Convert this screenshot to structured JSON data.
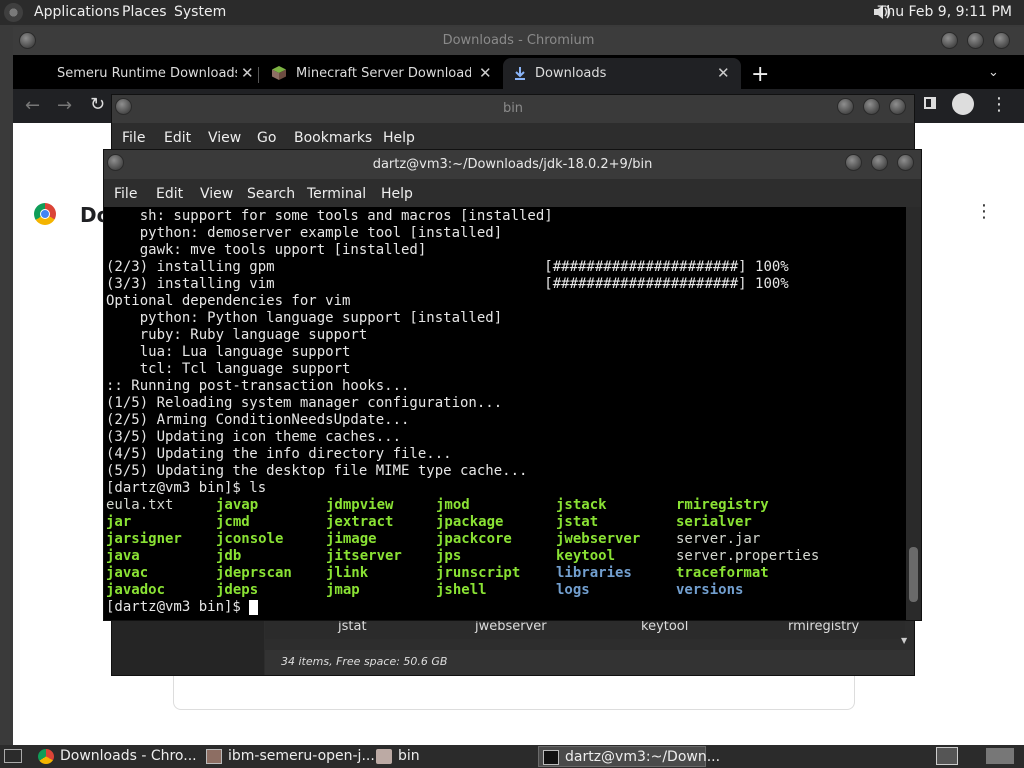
{
  "top_panel": {
    "menus": [
      "Applications",
      "Places",
      "System"
    ],
    "clock": "Thu Feb  9, 9:11 PM"
  },
  "chromium": {
    "title": "Downloads - Chromium",
    "tabs": [
      {
        "label": "Semeru Runtime Downloads -",
        "icon": "ibm-icon"
      },
      {
        "label": "Minecraft Server Download | M",
        "icon": "minecraft-block-icon"
      },
      {
        "label": "Downloads",
        "icon": "download-icon"
      }
    ],
    "new_tab": "+",
    "page_title_partial": "Do"
  },
  "file_manager": {
    "title": "bin",
    "menu": [
      "File",
      "Edit",
      "View",
      "Go",
      "Bookmarks",
      "Help"
    ],
    "grid_items": [
      "jstat",
      "jwebserver",
      "keytool",
      "rmiregistry"
    ],
    "status": "34 items, Free space: 50.6 GB"
  },
  "terminal": {
    "title": "dartz@vm3:~/Downloads/jdk-18.0.2+9/bin",
    "menu": [
      "File",
      "Edit",
      "View",
      "Search",
      "Terminal",
      "Help"
    ],
    "lines": [
      "    sh: support for some tools and macros [installed]",
      "    python: demoserver example tool [installed]",
      "    gawk: mve tools upport [installed]",
      "(2/3) installing gpm                                [######################] 100%",
      "(3/3) installing vim                                [######################] 100%",
      "Optional dependencies for vim",
      "    python: Python language support [installed]",
      "    ruby: Ruby language support",
      "    lua: Lua language support",
      "    tcl: Tcl language support",
      ":: Running post-transaction hooks...",
      "(1/5) Reloading system manager configuration...",
      "(2/5) Arming ConditionNeedsUpdate...",
      "(3/5) Updating icon theme caches...",
      "(4/5) Updating the info directory file...",
      "(5/5) Updating the desktop file MIME type cache...",
      "[dartz@vm3 bin]$ ls"
    ],
    "ls_columns": [
      [
        {
          "n": "eula.txt",
          "t": "file"
        },
        {
          "n": "jar",
          "t": "exec"
        },
        {
          "n": "jarsigner",
          "t": "exec"
        },
        {
          "n": "java",
          "t": "exec"
        },
        {
          "n": "javac",
          "t": "exec"
        },
        {
          "n": "javadoc",
          "t": "exec"
        }
      ],
      [
        {
          "n": "javap",
          "t": "exec"
        },
        {
          "n": "jcmd",
          "t": "exec"
        },
        {
          "n": "jconsole",
          "t": "exec"
        },
        {
          "n": "jdb",
          "t": "exec"
        },
        {
          "n": "jdeprscan",
          "t": "exec"
        },
        {
          "n": "jdeps",
          "t": "exec"
        }
      ],
      [
        {
          "n": "jdmpview",
          "t": "exec"
        },
        {
          "n": "jextract",
          "t": "exec"
        },
        {
          "n": "jimage",
          "t": "exec"
        },
        {
          "n": "jitserver",
          "t": "exec"
        },
        {
          "n": "jlink",
          "t": "exec"
        },
        {
          "n": "jmap",
          "t": "exec"
        }
      ],
      [
        {
          "n": "jmod",
          "t": "exec"
        },
        {
          "n": "jpackage",
          "t": "exec"
        },
        {
          "n": "jpackcore",
          "t": "exec"
        },
        {
          "n": "jps",
          "t": "exec"
        },
        {
          "n": "jrunscript",
          "t": "exec"
        },
        {
          "n": "jshell",
          "t": "exec"
        }
      ],
      [
        {
          "n": "jstack",
          "t": "exec"
        },
        {
          "n": "jstat",
          "t": "exec"
        },
        {
          "n": "jwebserver",
          "t": "exec"
        },
        {
          "n": "keytool",
          "t": "exec"
        },
        {
          "n": "libraries",
          "t": "dir"
        },
        {
          "n": "logs",
          "t": "dir"
        }
      ],
      [
        {
          "n": "rmiregistry",
          "t": "exec"
        },
        {
          "n": "serialver",
          "t": "exec"
        },
        {
          "n": "server.jar",
          "t": "file"
        },
        {
          "n": "server.properties",
          "t": "file"
        },
        {
          "n": "traceformat",
          "t": "exec"
        },
        {
          "n": "versions",
          "t": "dir"
        }
      ]
    ],
    "prompt": "[dartz@vm3 bin]$ ",
    "colors": {
      "exec": "#8ae234",
      "dir": "#729fcf",
      "file": "#d3d7cf"
    }
  },
  "taskbar": {
    "tasks": [
      {
        "label": "Downloads - Chro...",
        "icon": "chromium-icon"
      },
      {
        "label": "ibm-semeru-open-j...",
        "icon": "archive-icon"
      },
      {
        "label": "bin",
        "icon": "folder-icon"
      },
      {
        "label": "dartz@vm3:~/Down...",
        "icon": "terminal-icon"
      }
    ]
  }
}
